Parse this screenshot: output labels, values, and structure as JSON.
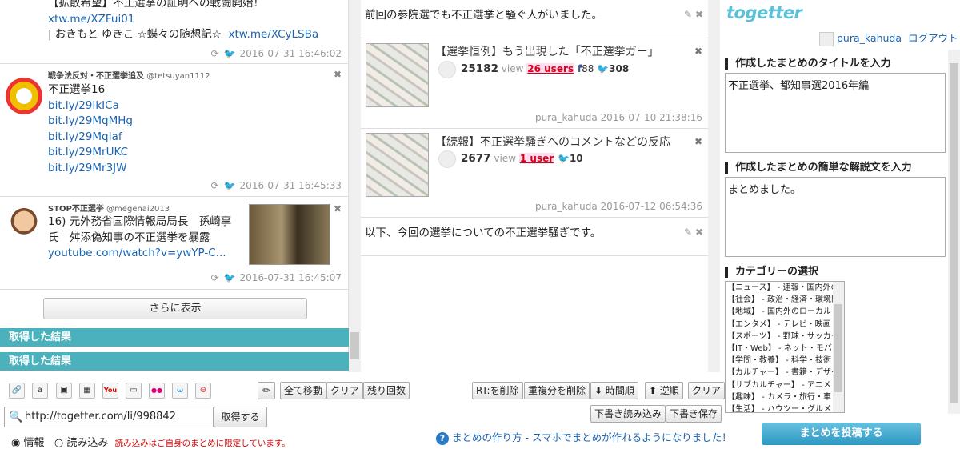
{
  "left_tweets": [
    {
      "lines": [
        "【拡散希望】不正選挙の証明への戦闘開始！"
      ],
      "links": [
        "xtw.me/XZFui01"
      ],
      "extra": "| おきもと ゆきこ ☆蝶々の随想記☆",
      "extra_link": "xtw.me/XCyLSBa",
      "time": "2016-07-31 16:46:02"
    },
    {
      "user": "戦争法反対・不正選挙追及",
      "handle": "@tetsuyan1112",
      "lines": [
        "不正選挙16"
      ],
      "links": [
        "bit.ly/29IkICa",
        "bit.ly/29MqMHg",
        "bit.ly/29MqIaf",
        "bit.ly/29MrUKC",
        "bit.ly/29Mr3JW"
      ],
      "time": "2016-07-31 16:45:33"
    },
    {
      "user": "STOP不正選挙",
      "handle": "@megenai2013",
      "lines": [
        "16) 元外務省国際情報局局長　孫崎享",
        "氏　舛添偽知事の不正選挙を暴露"
      ],
      "links": [
        "youtube.com/watch?v=ywYP-C..."
      ],
      "time": "2016-07-31 16:45:07"
    }
  ],
  "more_label": "さらに表示",
  "results": [
    "取得した結果",
    "取得した結果"
  ],
  "middle": {
    "comment1": "前回の参院選でも不正選挙と騒ぐ人がいました。",
    "cards": [
      {
        "title": "【選挙恒例】もう出現した「不正選挙ガー」",
        "views": "25182",
        "view_label": "view",
        "users": "26 users",
        "fb": "88",
        "tw": "308",
        "who": "pura_kahuda 2016-07-10 21:38:16"
      },
      {
        "title": "【続報】不正選挙騒ぎへのコメントなどの反応",
        "views": "2677",
        "view_label": "view",
        "users": "1 user",
        "tw": "10",
        "who": "pura_kahuda 2016-07-12 06:54:36"
      }
    ],
    "comment2": "以下、今回の選挙についての不正選挙騒ぎです。"
  },
  "right": {
    "logo": "togetter",
    "username": "pura_kahuda",
    "logout": "ログアウト",
    "title_label": "作成したまとめのタイトルを入力",
    "title_value": "不正選挙、都知事選2016年編",
    "desc_label": "作成したまとめの簡単な解説文を入力",
    "desc_value": "まとめました。",
    "cat_label": "カテゴリーの選択",
    "categories": [
      "【ニュース】 - 速報・国内外の",
      "【社会】 - 政治・経済・環境問",
      "【地域】 - 国内外のローカル",
      "【エンタメ】 - テレビ・映画・音",
      "【スポーツ】 - 野球・サッカー",
      "【IT・Web】 - ネット・モバイル",
      "【学問・教養】 - 科学・技術・",
      "【カルチャー】 - 書籍・デザイ",
      "【サブカルチャー】 - アニメ・",
      "【趣味】 - カメラ・旅行・車・ア",
      "【生活】 - ハウツー・グルメ・"
    ],
    "post_label": "まとめを投稿する"
  },
  "toolbar": {
    "icons": [
      "link-icon",
      "amazon-icon",
      "image-icon",
      "map-icon",
      "youtube-icon",
      "tv-icon",
      "flickr-icon",
      "ustream-icon",
      "block-icon"
    ],
    "icon_glyphs": [
      "🔗",
      "a",
      "▣",
      "▦",
      "You",
      "▭",
      "●●",
      "ω",
      "⊖"
    ],
    "move_all": "全て移動",
    "clear1": "クリア",
    "remaining": "残り回数",
    "rt_delete": "RT:を削除",
    "dup_delete": "重複分を削除",
    "time_order": "時間順",
    "reverse": "逆順",
    "clear2": "クリア",
    "draft_load": "下書き読み込み",
    "draft_save": "下書き保存",
    "url_value": "http://togetter.com/li/998842",
    "fetch": "取得する",
    "radio_info": "情報",
    "radio_load": "読み込み",
    "note": "読み込みはご自身のまとめに限定しています。",
    "help1": "まとめの作り方",
    "help_sep": "-",
    "help2": "スマホでまとめが作れるようになりました！"
  }
}
